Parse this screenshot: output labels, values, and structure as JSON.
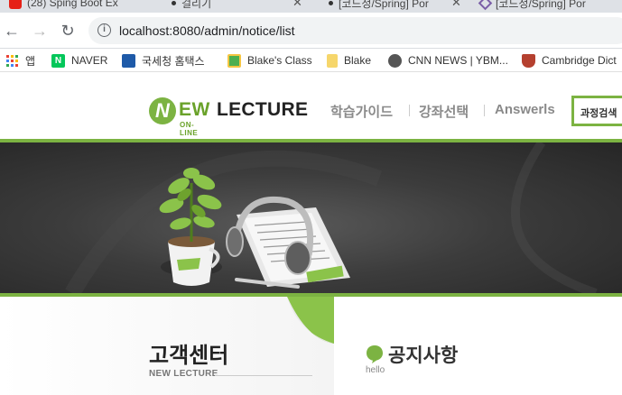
{
  "browser": {
    "tabs": [
      {
        "title": "(28) Sping Boot Ex",
        "favicon": "youtube-icon"
      },
      {
        "title": "걸리기",
        "favicon": "dot-icon"
      },
      {
        "title": "[코드정/Spring] Por",
        "favicon": "dot-icon"
      },
      {
        "title": "[코드정/Spring] Por",
        "favicon": "hex-icon"
      }
    ],
    "url_host": "localhost",
    "url_rest": ":8080/admin/notice/list",
    "bookmarks": [
      {
        "label": "앱",
        "icon": "apps-grid-icon"
      },
      {
        "label": "NAVER",
        "icon": "naver-icon",
        "color": "#03c75a"
      },
      {
        "label": "국세청 홈택스",
        "icon": "hometax-icon",
        "color": "#1e5aa8"
      },
      {
        "label": "Blake's Class",
        "icon": "class-icon",
        "color": "#4caf50"
      },
      {
        "label": "Blake",
        "icon": "folder-icon",
        "color": "#f6d66b"
      },
      {
        "label": "CNN NEWS | YBM...",
        "icon": "globe-icon"
      },
      {
        "label": "Cambridge Dict",
        "icon": "cambridge-icon",
        "color": "#b5402f"
      }
    ]
  },
  "site": {
    "logo": {
      "n": "N",
      "ew": "EW",
      "lecture": "LECTURE",
      "online": "ON-LINE"
    },
    "menu": [
      "학습가이드",
      "강좌선택",
      "Answerls"
    ],
    "course_search": "과정검색",
    "accent_color": "#7cb342",
    "sidebar_title": "고객센터",
    "sidebar_eng": "NEW LECTURE",
    "page_title": "공지사항",
    "page_subtitle": "hello"
  }
}
